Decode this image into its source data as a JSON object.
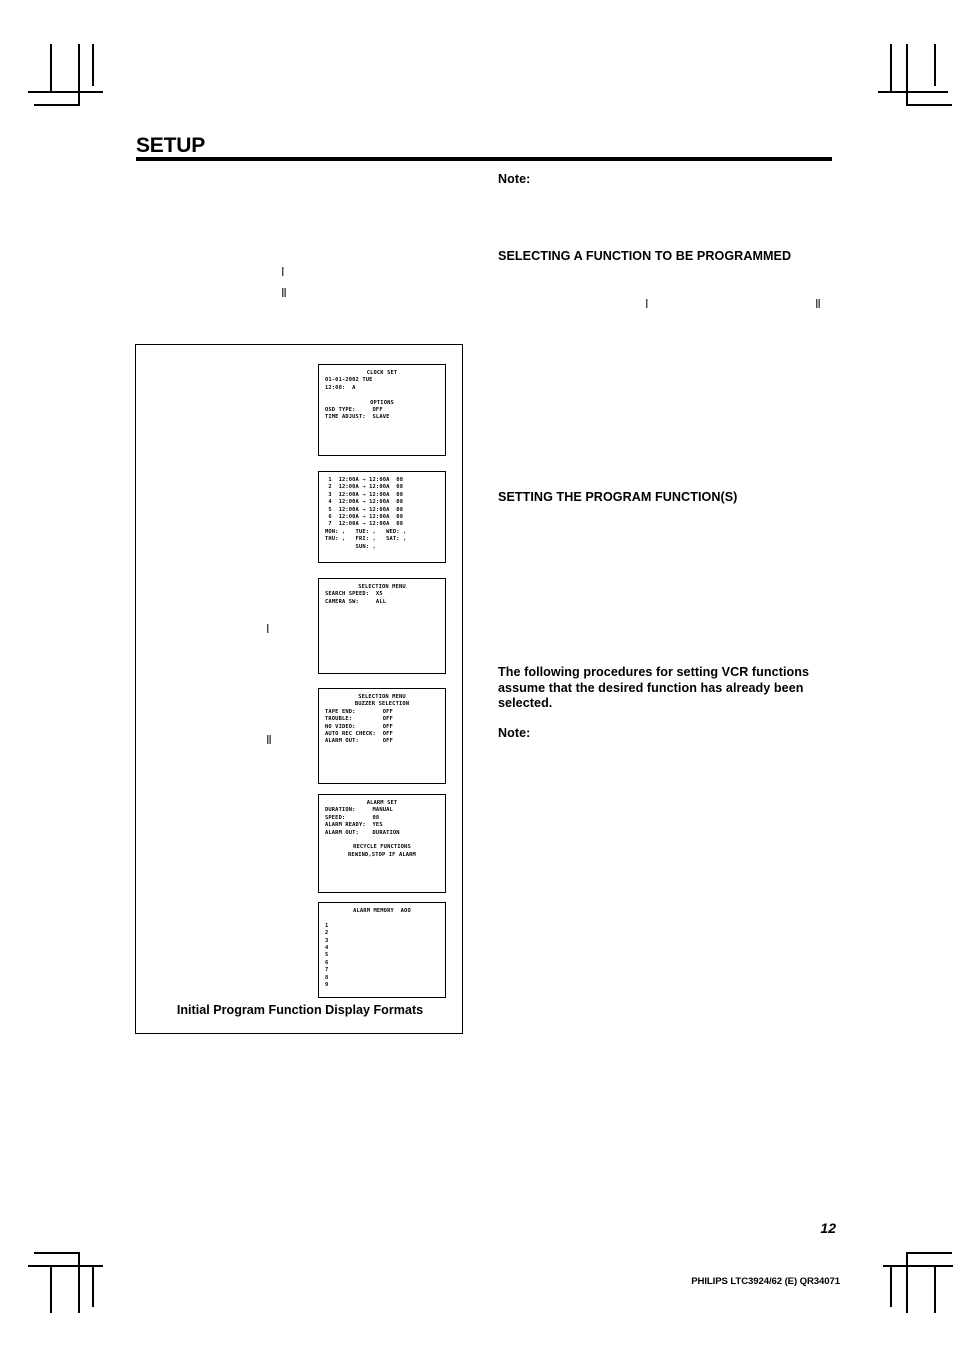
{
  "page": {
    "title": "SETUP",
    "number": "12",
    "imprint": "PHILIPS LTC3924/62 (E) QR34071"
  },
  "left_column": {
    "roman_marker_1": "Ⅰ",
    "roman_marker_2": "Ⅱ",
    "figure_roman_1": "Ⅰ",
    "figure_roman_2": "Ⅱ"
  },
  "right_column": {
    "note_top": "Note:",
    "heading_selecting": "SELECTING A FUNCTION TO BE PROGRAMMED",
    "roman_marker_1": "Ⅰ",
    "roman_marker_2": "Ⅱ",
    "heading_setting": "SETTING THE PROGRAM FUNCTION(S)",
    "paragraph": "The following procedures for setting VCR functions assume that the desired function has already been selected.",
    "note_bottom": "Note:"
  },
  "figure": {
    "caption": "Initial Program Function Display Formats",
    "screens": [
      {
        "name": "clock-set",
        "lines": [
          {
            "text": "CLOCK SET",
            "align": "center"
          },
          {
            "text": "01-01-2002 TUE",
            "align": "left"
          },
          {
            "text": "12:00:  A",
            "align": "left"
          },
          {
            "text": " ",
            "align": "left"
          },
          {
            "text": "OPTIONS",
            "align": "center"
          },
          {
            "text": "OSD TYPE:     OFF",
            "align": "left"
          },
          {
            "text": "TIME ADJUST:  SLAVE",
            "align": "left"
          }
        ]
      },
      {
        "name": "timer-program",
        "lines": [
          {
            "text": " 1  12:00A → 12:00A  08",
            "align": "left"
          },
          {
            "text": " 2  12:00A → 12:00A  08",
            "align": "left"
          },
          {
            "text": " 3  12:00A → 12:00A  08",
            "align": "left"
          },
          {
            "text": " 4  12:00A → 12:00A  08",
            "align": "left"
          },
          {
            "text": " 5  12:00A → 12:00A  08",
            "align": "left"
          },
          {
            "text": " 6  12:00A → 12:00A  08",
            "align": "left"
          },
          {
            "text": " 7  12:00A → 12:00A  08",
            "align": "left"
          },
          {
            "text": "MON: ,   TUE: ,   WED: ,",
            "align": "left"
          },
          {
            "text": "THU: ,   FRI: ,   SAT: ,",
            "align": "left"
          },
          {
            "text": "         SUN: ,",
            "align": "left"
          }
        ]
      },
      {
        "name": "selection-menu-search",
        "lines": [
          {
            "text": "SELECTION MENU",
            "align": "center"
          },
          {
            "text": "SEARCH SPEED:  X5",
            "align": "left"
          },
          {
            "text": "CAMERA SW:     ALL",
            "align": "left"
          }
        ]
      },
      {
        "name": "selection-menu-buzzer",
        "lines": [
          {
            "text": "SELECTION MENU",
            "align": "center"
          },
          {
            "text": "BUZZER SELECTION",
            "align": "center"
          },
          {
            "text": "TAPE END:        OFF",
            "align": "left"
          },
          {
            "text": "TROUBLE:         OFF",
            "align": "left"
          },
          {
            "text": "NO VIDEO:        OFF",
            "align": "left"
          },
          {
            "text": "AUTO REC CHECK:  OFF",
            "align": "left"
          },
          {
            "text": "ALARM OUT:       OFF",
            "align": "left"
          }
        ]
      },
      {
        "name": "alarm-set",
        "lines": [
          {
            "text": "ALARM SET",
            "align": "center"
          },
          {
            "text": "DURATION:     MANUAL",
            "align": "left"
          },
          {
            "text": "SPEED:        08",
            "align": "left"
          },
          {
            "text": "ALARM READY:  YES",
            "align": "left"
          },
          {
            "text": "ALARM OUT:    DURATION",
            "align": "left"
          },
          {
            "text": " ",
            "align": "left"
          },
          {
            "text": "RECYCLE FUNCTIONS",
            "align": "center"
          },
          {
            "text": "REWIND,STOP IF ALARM",
            "align": "center"
          }
        ]
      },
      {
        "name": "alarm-memory",
        "lines": [
          {
            "text": "ALARM MEMORY  AOO",
            "align": "center"
          },
          {
            "text": " ",
            "align": "left"
          },
          {
            "text": "1",
            "align": "left"
          },
          {
            "text": "2",
            "align": "left"
          },
          {
            "text": "3",
            "align": "left"
          },
          {
            "text": "4",
            "align": "left"
          },
          {
            "text": "5",
            "align": "left"
          },
          {
            "text": "6",
            "align": "left"
          },
          {
            "text": "7",
            "align": "left"
          },
          {
            "text": "8",
            "align": "left"
          },
          {
            "text": "9",
            "align": "left"
          }
        ]
      }
    ]
  }
}
